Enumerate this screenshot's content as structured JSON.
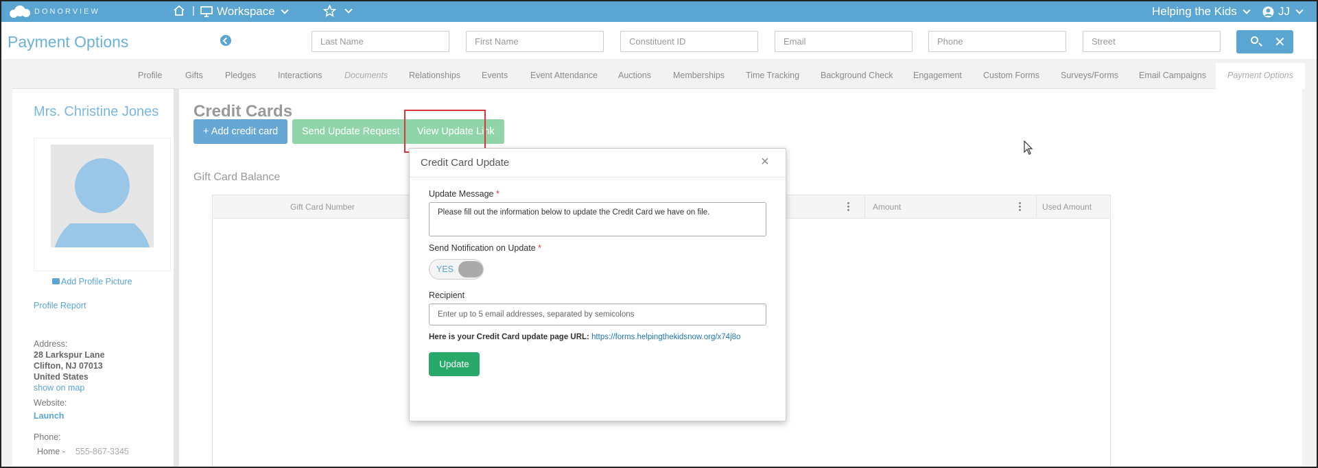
{
  "colors": {
    "accent": "#5aa5d2",
    "success": "#28a96a",
    "highlight": "#d9343c"
  },
  "topbar": {
    "brand": "DONORVIEW",
    "workspace": "Workspace",
    "organization": "Helping the Kids",
    "user_initials": "JJ",
    "separator": "|"
  },
  "header": {
    "page_title": "Payment Options",
    "search": {
      "last_name": "Last Name",
      "first_name": "First Name",
      "constituent_id": "Constituent ID",
      "email": "Email",
      "phone": "Phone",
      "street": "Street"
    },
    "clear_glyph": "✕"
  },
  "tabs": [
    "Profile",
    "Gifts",
    "Pledges",
    "Interactions",
    "Documents",
    "Relationships",
    "Events",
    "Event Attendance",
    "Auctions",
    "Memberships",
    "Time Tracking",
    "Background Check",
    "Engagement",
    "Custom Forms",
    "Surveys/Forms",
    "Email Campaigns",
    "Payment Options"
  ],
  "profile": {
    "name": "Mrs. Christine Jones",
    "add_picture": "Add Profile Picture",
    "profile_report": "Profile Report",
    "address_label": "Address:",
    "address_line1": "28 Larkspur Lane",
    "address_line2": "Clifton, NJ 07013",
    "address_line3": "United States",
    "show_on_map": "show on map",
    "website_label": "Website:",
    "website_value": "Launch",
    "phone_label": "Phone:",
    "phone_type": "Home -",
    "phone_value": "555-867-3345"
  },
  "main": {
    "section_title": "Credit Cards",
    "add_credit_card": "+ Add credit card",
    "send_update_request": "Send Update Request",
    "view_update_link": "View Update Link",
    "gift_card_title": "Gift Card Balance",
    "grid_columns": [
      "Gift Card Number",
      "Amount",
      "Used Amount"
    ]
  },
  "modal": {
    "title": "Credit Card Update",
    "close_glyph": "×",
    "update_message_label": "Update Message",
    "required_mark": "*",
    "update_message_value": "Please fill out the information below to update the Credit Card we have on file.",
    "send_notification_label": "Send Notification on Update",
    "toggle_value": "YES",
    "recipient_label": "Recipient",
    "recipient_placeholder": "Enter up to 5 email addresses, separated by semicolons",
    "url_prefix": "Here is your Credit Card update page URL:",
    "url": "https://forms.helpingthekidsnow.org/x74j8o",
    "update_button": "Update"
  }
}
